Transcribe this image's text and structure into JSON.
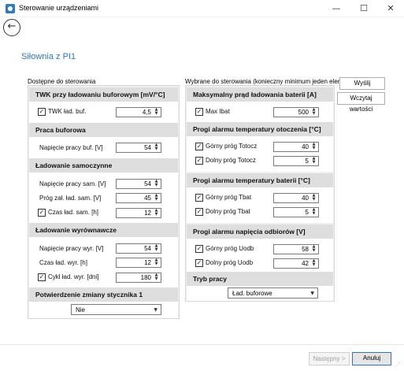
{
  "window": {
    "title": "Sterowanie urządzeniami",
    "minimize_glyph": "—",
    "maximize_glyph": "☐",
    "close_glyph": "✕"
  },
  "back_glyph": "←",
  "page_title": "Siłownia z PI1",
  "left_column": {
    "label": "Dostępne do sterowania",
    "groups": [
      {
        "title": "TWK przy ładowaniu buforowym [mV/°C]",
        "rows": [
          {
            "label": "TWK ład. buf.",
            "checked": true,
            "value": "4,5"
          }
        ]
      },
      {
        "title": "Praca buforowa",
        "rows": [
          {
            "label": "Napięcie pracy buf. [V]",
            "checked": false,
            "value": "54"
          }
        ]
      },
      {
        "title": "Ładowanie samoczynne",
        "rows": [
          {
            "label": "Napięcie pracy sam. [V]",
            "checked": false,
            "value": "54"
          },
          {
            "label": "Próg zał. ład. sam. [V]",
            "checked": false,
            "value": "45"
          },
          {
            "label": "Czas ład. sam. [h]",
            "checked": true,
            "value": "12"
          }
        ]
      },
      {
        "title": "Ładowanie wyrównawcze",
        "rows": [
          {
            "label": "Napięcie pracy wyr. [V]",
            "checked": false,
            "value": "54"
          },
          {
            "label": "Czas ład. wyr. [h]",
            "checked": false,
            "value": "12"
          },
          {
            "label": "Cykl ład. wyr. [dni]",
            "checked": true,
            "value": "180"
          }
        ]
      },
      {
        "title": "Potwierdzenie zmiany stycznika 1",
        "dropdown": "Nie"
      }
    ]
  },
  "right_column": {
    "label": "Wybrane do sterowania (konieczny minimum jeden element)",
    "groups": [
      {
        "title": "Maksymalny prąd ładowania baterii [A]",
        "rows": [
          {
            "label": "Max Ibat",
            "checked": true,
            "value": "500"
          }
        ]
      },
      {
        "title": "Progi alarmu temperatury otoczenia [°C]",
        "rows": [
          {
            "label": "Górny próg Totocz",
            "checked": true,
            "value": "40"
          },
          {
            "label": "Dolny próg Totocz",
            "checked": true,
            "value": "5"
          }
        ]
      },
      {
        "title": "Progi alarmu temperatury baterii [°C]",
        "rows": [
          {
            "label": "Górny próg Tbat",
            "checked": true,
            "value": "40"
          },
          {
            "label": "Dolny próg Tbat",
            "checked": true,
            "value": "5"
          }
        ]
      },
      {
        "title": "Progi alarmu napięcia odbiorów [V]",
        "rows": [
          {
            "label": "Górny próg Uodb",
            "checked": true,
            "value": "58"
          },
          {
            "label": "Dolny próg Uodb",
            "checked": true,
            "value": "42"
          }
        ]
      },
      {
        "title": "Tryb pracy",
        "dropdown": "Ład. buforowe"
      }
    ]
  },
  "buttons": {
    "send": "Wyślij",
    "load": "Wczytaj wartości",
    "next": "Następny >",
    "cancel": "Anuluj"
  },
  "icons": {
    "check": "✓",
    "spin": "▲▼",
    "dropdown_arrow": "▼"
  }
}
